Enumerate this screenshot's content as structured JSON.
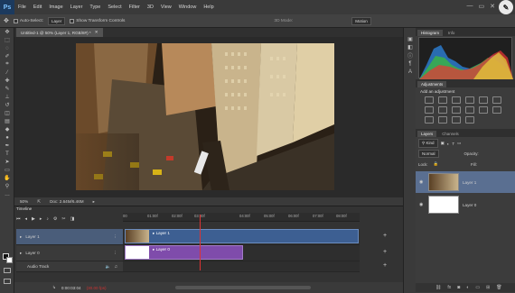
{
  "menubar": {
    "app_logo": "Ps",
    "items": [
      "File",
      "Edit",
      "Image",
      "Layer",
      "Type",
      "Select",
      "Filter",
      "3D",
      "View",
      "Window",
      "Help"
    ],
    "window_controls": [
      "—",
      "▭",
      "✕"
    ]
  },
  "optionsbar": {
    "auto_select": "Auto-Select:",
    "auto_select_value": "Layer",
    "show_transform": "Show Transform Controls",
    "mode_3d": "3D Mode:",
    "workspace": "Motion"
  },
  "document": {
    "tab_label": "Untitled-1 @ 50% (Layer 1, RGB/8#) *",
    "zoom": "50%",
    "doc_size": "Doc: 2.64M/6.46M"
  },
  "timeline": {
    "title": "Timeline",
    "ruler_labels": [
      "00",
      "01:00f",
      "02:00f",
      "03:00f",
      "04:00f",
      "05:00f",
      "06:00f",
      "07:00f",
      "08:00f",
      "09:00f"
    ],
    "tracks": [
      {
        "name": "Layer 1",
        "clip": "Layer 1"
      },
      {
        "name": "Layer 0",
        "clip": "Layer 0"
      },
      {
        "name": "Audio Track",
        "clip": ""
      }
    ],
    "timecode": "0:00:03:04",
    "fps": "(30.00 fps)"
  },
  "panels": {
    "tabs_top": [
      "Histogram",
      "Info"
    ],
    "tabs_adjust": [
      "Adjustments"
    ],
    "add_adjustment": "Add an adjustment",
    "tabs_layers": [
      "Layers",
      "Channels"
    ],
    "kind": "Kind",
    "blend_mode": "Normal",
    "opacity_label": "Opacity:",
    "lock_label": "Lock:",
    "fill_label": "Fill:",
    "layers": [
      "Layer 1",
      "Layer 0"
    ]
  }
}
